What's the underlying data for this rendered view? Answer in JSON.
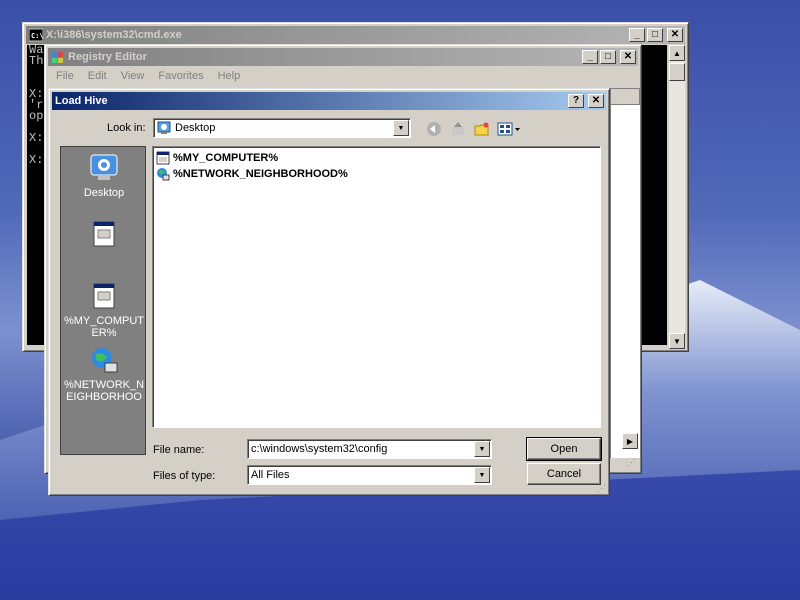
{
  "colors": {
    "accent": "#0a246a",
    "inactive_title": "#808080",
    "face": "#d4d0c8"
  },
  "cmd": {
    "title": "X:\\i386\\system32\\cmd.exe",
    "icon": "console-icon",
    "lines": [
      "Wa",
      "Th",
      "",
      "",
      "X:",
      "'r",
      "op",
      "",
      "X:",
      "",
      "X:"
    ]
  },
  "regedit": {
    "title": "Registry Editor",
    "icon": "registry-icon",
    "menu": [
      "File",
      "Edit",
      "View",
      "Favorites",
      "Help"
    ]
  },
  "dialog": {
    "title": "Load Hive",
    "help_label": "?",
    "close_label": "✕",
    "look_in_label": "Look in:",
    "look_in_value": "Desktop",
    "places": [
      {
        "label": "Desktop",
        "icon": "desktop-icon"
      },
      {
        "label": "",
        "icon": "document-window-icon"
      },
      {
        "label": "%MY_COMPUTER%",
        "icon": "document-window-icon"
      },
      {
        "label": "%NETWORK_NEIGHBORHOOD%",
        "icon": "network-globe-icon"
      }
    ],
    "files": [
      {
        "name": "%MY_COMPUTER%",
        "icon": "document-window-icon"
      },
      {
        "name": "%NETWORK_NEIGHBORHOOD%",
        "icon": "network-globe-icon"
      }
    ],
    "file_name_label": "File name:",
    "file_name_value": "c:\\windows\\system32\\config",
    "file_type_label": "Files of type:",
    "file_type_value": "All Files",
    "open_label": "Open",
    "cancel_label": "Cancel"
  }
}
